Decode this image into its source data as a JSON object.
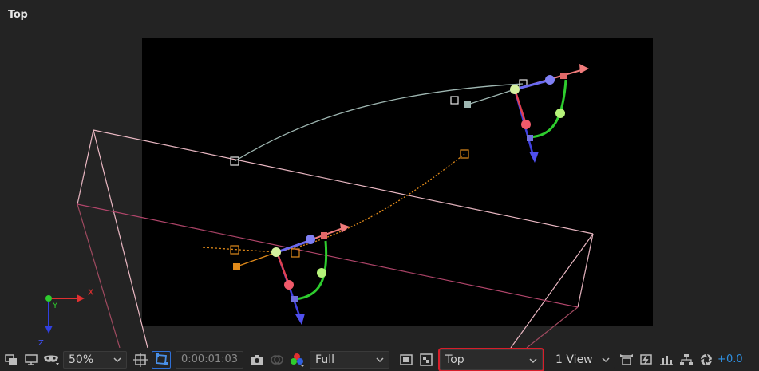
{
  "viewer": {
    "view_label": "Top",
    "axis": {
      "x": "X",
      "y": "Y",
      "z": "Z"
    }
  },
  "toolbar": {
    "magnification": "50%",
    "timecode": "0:00:01:03",
    "resolution": "Full",
    "view_layout_selector": "Top",
    "view_count": "1 View",
    "exposure": "+0.0",
    "icons": [
      "always-preview-icon",
      "monitor-icon",
      "mask-toggle-icon",
      "safe-zones-icon",
      "region-of-interest-icon",
      "snapshot-icon",
      "show-snapshot-icon",
      "color-channels-icon",
      "toggle-transparency-icon",
      "transparency-grid-icon",
      "reset-view-icon",
      "fast-preview-icon",
      "timeline-icon",
      "flowchart-icon",
      "reset-exposure-icon"
    ]
  },
  "colors": {
    "accent": "#2e6fd6",
    "highlight": "#d71e2a",
    "path_light": "#9fb7b2",
    "path_orange": "#e08a1a",
    "box_lines": "#e9b7c2"
  }
}
